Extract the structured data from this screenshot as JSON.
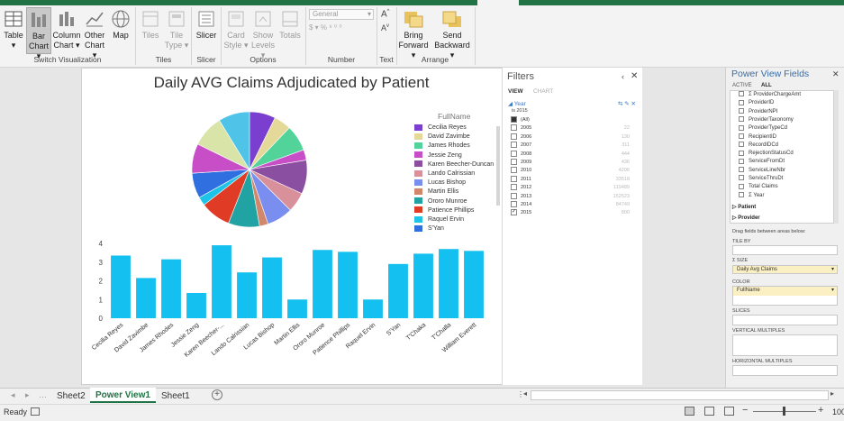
{
  "ribbon": {
    "buttons": [
      {
        "label": "Table",
        "sub": "▾",
        "icon": "table-icon"
      },
      {
        "label": "Bar",
        "sub": "Chart ▾",
        "icon": "bar-chart-icon",
        "selected": true
      },
      {
        "label": "Column",
        "sub": "Chart ▾",
        "icon": "column-chart-icon"
      },
      {
        "label": "Other",
        "sub": "Chart ▾",
        "icon": "line-chart-icon"
      },
      {
        "label": "Map",
        "sub": "",
        "icon": "globe-icon"
      },
      {
        "label": "Tiles",
        "sub": "",
        "icon": "tiles-icon"
      },
      {
        "label": "Tile",
        "sub": "Type ▾",
        "icon": "tile-type-icon"
      },
      {
        "label": "Slicer",
        "sub": "",
        "icon": "slicer-icon"
      },
      {
        "label": "Card",
        "sub": "Style ▾",
        "icon": "card-style-icon"
      },
      {
        "label": "Show",
        "sub": "Levels ▾",
        "icon": "show-levels-icon"
      },
      {
        "label": "Totals",
        "sub": "",
        "icon": "totals-icon"
      },
      {
        "label": "Bring",
        "sub": "Forward ▾",
        "icon": "bring-forward-icon"
      },
      {
        "label": "Send",
        "sub": "Backward ▾",
        "icon": "send-backward-icon"
      }
    ],
    "groups": [
      "Switch Visualization",
      "Tiles",
      "Slicer",
      "Options",
      "Number",
      "Text",
      "Arrange"
    ],
    "number_format": "General",
    "number_glyphs": "$ ▾  %  ⁹  ⁰ ⁰"
  },
  "sheet": {
    "title": "Daily AVG Claims Adjudicated by Patient"
  },
  "chart_data": [
    {
      "type": "pie",
      "legend_title": "FullName",
      "categories": [
        "Cecilia Reyes",
        "David Zavimbe",
        "James Rhodes",
        "Jessie Zeng",
        "Karen Beecher-Duncan",
        "Lando Calrissian",
        "Lucas Bishop",
        "Martin Ellis",
        "Ororo Munroe",
        "Patience Phillips",
        "Raquel Ervin",
        "S'Yan"
      ],
      "legend_colors": [
        "#7b3fd0",
        "#e5d99a",
        "#52d39a",
        "#c84ec8",
        "#8a4fa0",
        "#d8909a",
        "#7a8ef0",
        "#d3876a",
        "#22a3a3",
        "#e03b24",
        "#1ec4e8",
        "#2f6fe0"
      ],
      "slices": [
        {
          "value": 3.0,
          "color": "#7b3fd0"
        },
        {
          "value": 2.0,
          "color": "#e5d99a"
        },
        {
          "value": 3.0,
          "color": "#52d39a"
        },
        {
          "value": 1.2,
          "color": "#c84ec8"
        },
        {
          "value": 3.9,
          "color": "#8a4fa0"
        },
        {
          "value": 2.3,
          "color": "#d8909a"
        },
        {
          "value": 3.0,
          "color": "#7a8ef0"
        },
        {
          "value": 1.0,
          "color": "#d3876a"
        },
        {
          "value": 3.6,
          "color": "#22a3a3"
        },
        {
          "value": 3.5,
          "color": "#e03b24"
        },
        {
          "value": 1.0,
          "color": "#1ec4e8"
        },
        {
          "value": 2.9,
          "color": "#2f6fe0"
        },
        {
          "value": 3.4,
          "color": "#c84ec8"
        },
        {
          "value": 3.7,
          "color": "#d8e4a8"
        },
        {
          "value": 3.6,
          "color": "#4fc3e8"
        }
      ]
    },
    {
      "type": "bar",
      "categories": [
        "Cecilia Reyes",
        "David Zavimbe",
        "James Rhodes",
        "Jessie Zeng",
        "Karen Beecher-...",
        "Lando Calrissian",
        "Lucas Bishop",
        "Martin Ellis",
        "Ororo Munroe",
        "Patience Phillips",
        "Raquel Ervin",
        "S'Yan",
        "T'Chaka",
        "T'Challa",
        "William Everett"
      ],
      "values": [
        3.35,
        2.15,
        3.15,
        1.35,
        3.9,
        2.45,
        3.25,
        1.0,
        3.65,
        3.55,
        1.0,
        2.9,
        3.45,
        3.7,
        3.6
      ],
      "yticks": [
        "0",
        "1",
        "2",
        "3",
        "4"
      ],
      "ylim": [
        0,
        4
      ],
      "color": "#14c0f0"
    }
  ],
  "filters": {
    "title": "Filters",
    "tabs": [
      "VIEW",
      "CHART"
    ],
    "field": "Year",
    "subtitle": "is 2015",
    "items": [
      {
        "label": "(All)",
        "count": ""
      },
      {
        "label": "2005",
        "count": "22"
      },
      {
        "label": "2006",
        "count": "130"
      },
      {
        "label": "2007",
        "count": "311"
      },
      {
        "label": "2008",
        "count": "444"
      },
      {
        "label": "2009",
        "count": "436"
      },
      {
        "label": "2010",
        "count": "4206"
      },
      {
        "label": "2011",
        "count": "33518"
      },
      {
        "label": "2012",
        "count": "119489"
      },
      {
        "label": "2013",
        "count": "152523"
      },
      {
        "label": "2014",
        "count": "84749"
      },
      {
        "label": "2015",
        "count": "800",
        "checked": true
      }
    ]
  },
  "fields": {
    "title": "Power View Fields",
    "tabs": [
      "ACTIVE",
      "ALL"
    ],
    "list": [
      "Σ ProviderChargeAmt",
      "ProviderID",
      "ProviderNPI",
      "ProviderTaxonomy",
      "ProviderTypeCd",
      "RecipientID",
      "RecordIDCd",
      "RejectionStatusCd",
      "ServiceFromDt",
      "ServiceLineNbr",
      "ServiceThruDt",
      "Total Claims",
      "Σ Year"
    ],
    "tables": [
      "Patient",
      "Provider"
    ],
    "drag_hint": "Drag fields between areas below:",
    "wells": {
      "tile_by": "TILE BY",
      "size": "Σ SIZE",
      "size_value": "Daily Avg Claims",
      "color": "COLOR",
      "color_value": "FullName",
      "slices": "SLICES",
      "vertical": "VERTICAL MULTIPLES",
      "horizontal": "HORIZONTAL MULTIPLES"
    }
  },
  "tabs": [
    "Sheet2",
    "Power View1",
    "Sheet1"
  ],
  "status": {
    "ready": "Ready",
    "zoom": "100"
  }
}
